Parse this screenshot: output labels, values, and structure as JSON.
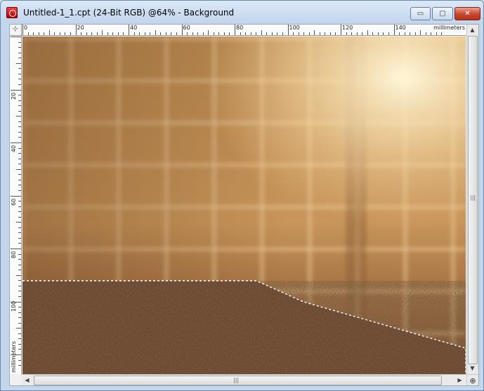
{
  "window": {
    "title": "Untitled-1_1.cpt (24-Bit RGB) @64% - Background",
    "minimize_label": "▭",
    "maximize_label": "▢",
    "close_label": "✕",
    "app_icon": "corel-photo-paint-icon"
  },
  "rulers": {
    "unit": "millimeters",
    "horizontal_labels": [
      "0",
      "20",
      "40",
      "60",
      "80",
      "100",
      "120",
      "140"
    ],
    "vertical_labels": [
      "20",
      "40",
      "60",
      "80",
      "100"
    ],
    "corner_icon": "ruler-origin-icon"
  },
  "canvas": {
    "zoom_percent": 64,
    "layer": "Background",
    "wall_color": "#c48a4e",
    "floor_color": "#3a2416",
    "selection": "dotted marquee around floor"
  },
  "scrollbars": {
    "up_arrow": "▲",
    "down_arrow": "▼",
    "left_arrow": "◀",
    "right_arrow": "▶",
    "grip": "|||",
    "zoom_icon": "navigator-icon"
  }
}
